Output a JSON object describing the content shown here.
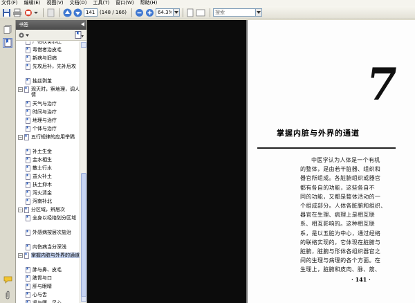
{
  "menu": [
    "文件(F)",
    "编辑(E)",
    "视图(V)",
    "文档(D)",
    "工具(T)",
    "窗口(W)",
    "帮助(H)"
  ],
  "toolbar": {
    "page_value": "141",
    "page_count": "(148 / 166)",
    "zoom_value": "64.3%",
    "search_placeholder": "搜索"
  },
  "panel": {
    "title": "书签"
  },
  "bookmarks": [
    {
      "label": "严格权衡邪正",
      "level": 2,
      "expander": "",
      "partial": true
    },
    {
      "label": "毒借者治皮毛",
      "level": 2,
      "expander": ""
    },
    {
      "label": "新病与旧病",
      "level": 2,
      "expander": ""
    },
    {
      "label": "先攻后补，先补后攻",
      "level": 2,
      "expander": ""
    },
    {
      "label": "抽丝剥茧",
      "level": 2,
      "expander": ""
    },
    {
      "label": "观天时，察地理，调人情",
      "level": 1,
      "expander": "−"
    },
    {
      "label": "天气与治疗",
      "level": 2,
      "expander": ""
    },
    {
      "label": "时间与治疗",
      "level": 2,
      "expander": ""
    },
    {
      "label": "地理与治疗",
      "level": 2,
      "expander": ""
    },
    {
      "label": "个体与治疗",
      "level": 2,
      "expander": ""
    },
    {
      "label": "五行规律的应用举隅",
      "level": 1,
      "expander": "−"
    },
    {
      "label": "补土生金",
      "level": 2,
      "expander": ""
    },
    {
      "label": "金水相生",
      "level": 2,
      "expander": ""
    },
    {
      "label": "散土行水",
      "level": 2,
      "expander": ""
    },
    {
      "label": "益火补土",
      "level": 2,
      "expander": ""
    },
    {
      "label": "扶土抑木",
      "level": 2,
      "expander": ""
    },
    {
      "label": "泻火清金",
      "level": 2,
      "expander": ""
    },
    {
      "label": "泻南补北",
      "level": 2,
      "expander": ""
    },
    {
      "label": "分区域，辨层次",
      "level": 1,
      "expander": "−"
    },
    {
      "label": "全身以经络划分区域",
      "level": 2,
      "expander": ""
    },
    {
      "label": "外感病按层次施治",
      "level": 2,
      "expander": ""
    },
    {
      "label": "内伤病当分深浅",
      "level": 2,
      "expander": ""
    },
    {
      "label": "掌握内脏与外界的通道",
      "level": 1,
      "expander": "−",
      "selected": true
    },
    {
      "label": "肺与鼻、皮毛",
      "level": 2,
      "expander": ""
    },
    {
      "label": "脾胃与口",
      "level": 2,
      "expander": ""
    },
    {
      "label": "肝与眼睛",
      "level": 2,
      "expander": ""
    },
    {
      "label": "心与舌",
      "level": 2,
      "expander": ""
    },
    {
      "label": "肾与腰、足心",
      "level": 2,
      "expander": ""
    }
  ],
  "document": {
    "chapter_number": "7",
    "chapter_title": "掌握内脏与外界的通道",
    "paragraph_lines": [
      "中医学认为人体是一个有机",
      "的整体，是由若干脏器、组织和",
      "器官所组成。各脏腑组织或器官",
      "都有各自的功能，这些各自不",
      "同的功能，又都是整体活动的一",
      "个组成部分。人体各脏腑和组织、",
      "器官在生理、病理上是相互联",
      "系、相互影响的。这种相互联",
      "系，是以五脏为中心，通过经络",
      "的联络实现的，它体现在脏腑与",
      "脏腑，脏腑与形体各组织器官之",
      "间的生理与病理的各个方面。在",
      "生理上，脏腑和皮肉、脉、筋、"
    ],
    "page_number": "· 141 ·"
  }
}
